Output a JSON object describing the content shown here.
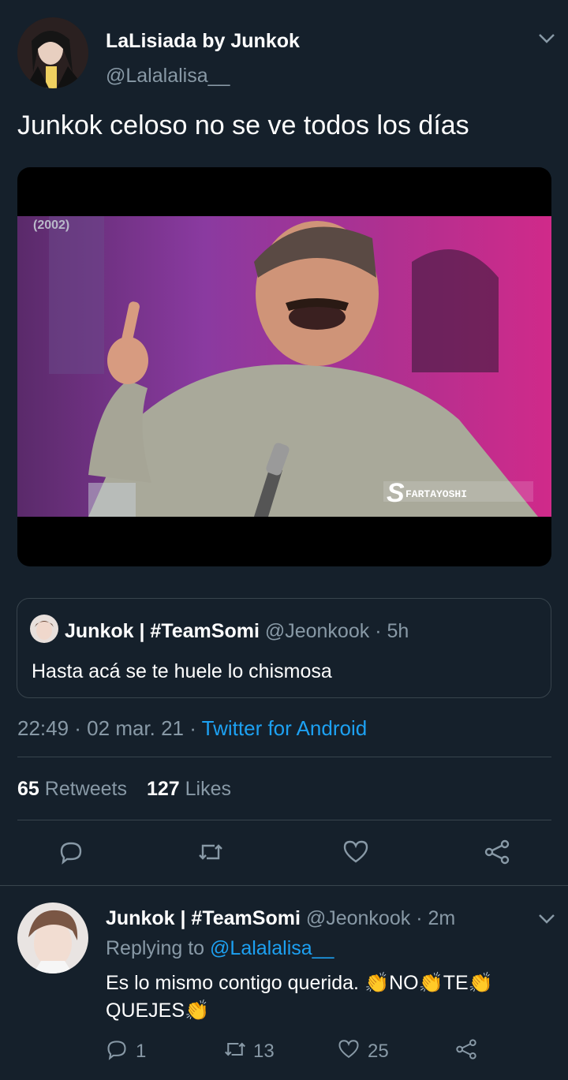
{
  "tweet": {
    "author_name": "LaLisiada by Junkok",
    "author_handle": "@Lalalalisa__",
    "text": "Junkok celoso no se ve todos los días",
    "media": {
      "video_year_label": "(2002)",
      "watermark": "FARTAYOSHI"
    },
    "quoted": {
      "author_name": "Junkok | #TeamSomi",
      "author_handle": "@Jeonkook",
      "time": "· 5h",
      "text": "Hasta acá se te huele lo chismosa"
    },
    "timestamp": "22:49 · 02 mar. 21 ·",
    "source": "Twitter for Android",
    "stats": {
      "retweets_count": "65",
      "retweets_label": "Retweets",
      "likes_count": "127",
      "likes_label": "Likes"
    }
  },
  "reply": {
    "author_name": "Junkok | #TeamSomi",
    "author_handle": "@Jeonkook",
    "time": "· 2m",
    "replying_label": "Replying to",
    "replying_to": "@Lalalalisa__",
    "text_line1": "Es lo mismo contigo querida. ",
    "word_no": "NO",
    "word_te": "TE",
    "text_line2": "QUEJES",
    "reply_count": "1",
    "retweet_count": "13",
    "like_count": "25"
  },
  "colors": {
    "background": "#15202b",
    "text": "#ffffff",
    "muted": "#8899a6",
    "accent": "#1da1f2",
    "divider": "#38444d"
  },
  "icons": [
    "chevron-down-icon",
    "reply-icon",
    "retweet-icon",
    "like-icon",
    "share-icon",
    "clap-emoji"
  ]
}
